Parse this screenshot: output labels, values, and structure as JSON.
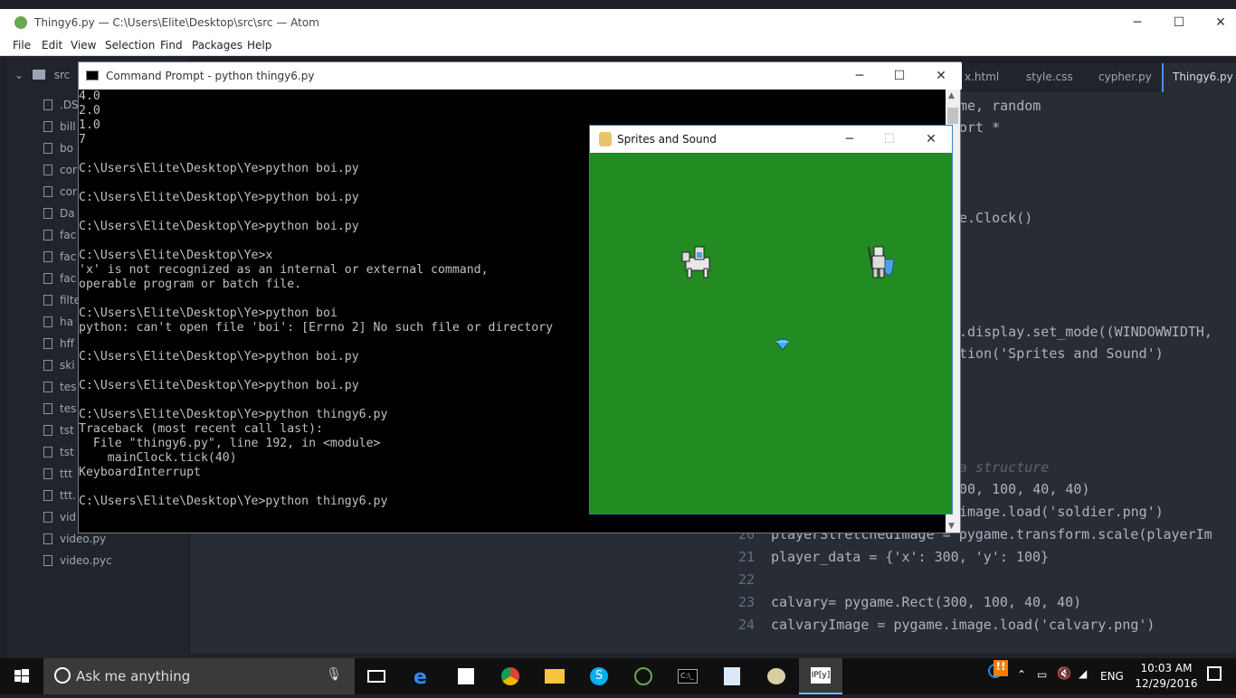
{
  "atom": {
    "title": "Thingy6.py — C:\\Users\\Elite\\Desktop\\src\\src — Atom",
    "menu": [
      "File",
      "Edit",
      "View",
      "Selection",
      "Find",
      "Packages",
      "Help"
    ],
    "tree_root": "src",
    "tree_items": [
      ".DS",
      "bill",
      "bo",
      "cor",
      "cor",
      "Da",
      "fac",
      "fac",
      "fac",
      "filte",
      "ha",
      "hff",
      "ski",
      "tes",
      "tes",
      "tst",
      "tst",
      "ttt",
      "ttt.",
      "vid",
      "video.py",
      "video.pyc"
    ],
    "tabs": [
      "x.html",
      "style.css",
      "cypher.py",
      "Thingy6.py"
    ],
    "active_tab": "Thingy6.py",
    "code_lines": [
      {
        "num": "",
        "text": "me, random"
      },
      {
        "num": "",
        "text": "ort *"
      },
      {
        "num": "",
        "text": "e.Clock()"
      },
      {
        "num": "",
        "text": ".display.set_mode((WINDOWWIDTH,"
      },
      {
        "num": "",
        "text": "tion('Sprites and Sound')"
      },
      {
        "num": "",
        "text": "a structure"
      },
      {
        "num": "",
        "text": "00, 100, 40, 40)"
      },
      {
        "num": "",
        "text": "image.load('soldier.png')"
      },
      {
        "num": "20",
        "text": "playerStretchedImage = pygame.transform.scale(playerIm"
      },
      {
        "num": "21",
        "text": "player_data = {'x': 300, 'y': 100}"
      },
      {
        "num": "22",
        "text": ""
      },
      {
        "num": "23",
        "text": "calvary= pygame.Rect(300, 100, 40, 40)"
      },
      {
        "num": "24",
        "text": "calvaryImage = pygame.image.load('calvary.png')"
      }
    ]
  },
  "cmd": {
    "title": "Command Prompt - python  thingy6.py",
    "lines": [
      "4.0",
      "2.0",
      "1.0",
      "7",
      "",
      "C:\\Users\\Elite\\Desktop\\Ye>python boi.py",
      "",
      "C:\\Users\\Elite\\Desktop\\Ye>python boi.py",
      "",
      "C:\\Users\\Elite\\Desktop\\Ye>python boi.py",
      "",
      "C:\\Users\\Elite\\Desktop\\Ye>x",
      "'x' is not recognized as an internal or external command,",
      "operable program or batch file.",
      "",
      "C:\\Users\\Elite\\Desktop\\Ye>python boi",
      "python: can't open file 'boi': [Errno 2] No such file or directory",
      "",
      "C:\\Users\\Elite\\Desktop\\Ye>python boi.py",
      "",
      "C:\\Users\\Elite\\Desktop\\Ye>python boi.py",
      "",
      "C:\\Users\\Elite\\Desktop\\Ye>python thingy6.py",
      "Traceback (most recent call last):",
      "  File \"thingy6.py\", line 192, in <module>",
      "    mainClock.tick(40)",
      "KeyboardInterrupt",
      "",
      "C:\\Users\\Elite\\Desktop\\Ye>python thingy6.py"
    ]
  },
  "pygame": {
    "title": "Sprites and Sound",
    "background": "#228b22"
  },
  "taskbar": {
    "search_placeholder": "Ask me anything",
    "language": "ENG",
    "time": "10:03 AM",
    "date": "12/29/2016"
  }
}
